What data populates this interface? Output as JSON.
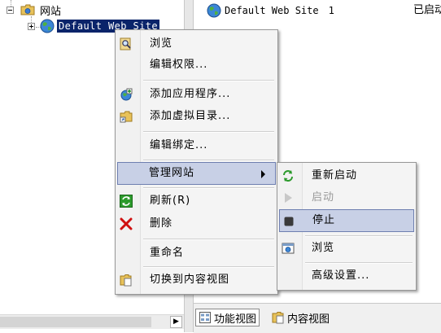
{
  "tree": {
    "root_label": "网站",
    "site_label": "Default Web Site"
  },
  "content": {
    "site_name": "Default Web Site",
    "site_id": "1",
    "status": "已启动"
  },
  "view_bar": {
    "features_view": "功能视图",
    "content_view": "内容视图"
  },
  "context_menu": {
    "browse": "浏览",
    "edit_permissions": "编辑权限...",
    "add_application": "添加应用程序...",
    "add_virtual_directory": "添加虚拟目录...",
    "edit_bindings": "编辑绑定...",
    "manage_website": "管理网站",
    "refresh": "刷新(R)",
    "delete": "删除",
    "rename": "重命名",
    "switch_to_content_view": "切换到内容视图"
  },
  "submenu": {
    "restart": "重新启动",
    "start": "启动",
    "stop": "停止",
    "browse": "浏览",
    "advanced_settings": "高级设置..."
  },
  "colors": {
    "selection": "#0a246a",
    "menu_highlight": "#c8d0e6",
    "delete_red": "#d01010",
    "refresh_green": "#2c9a2c"
  }
}
